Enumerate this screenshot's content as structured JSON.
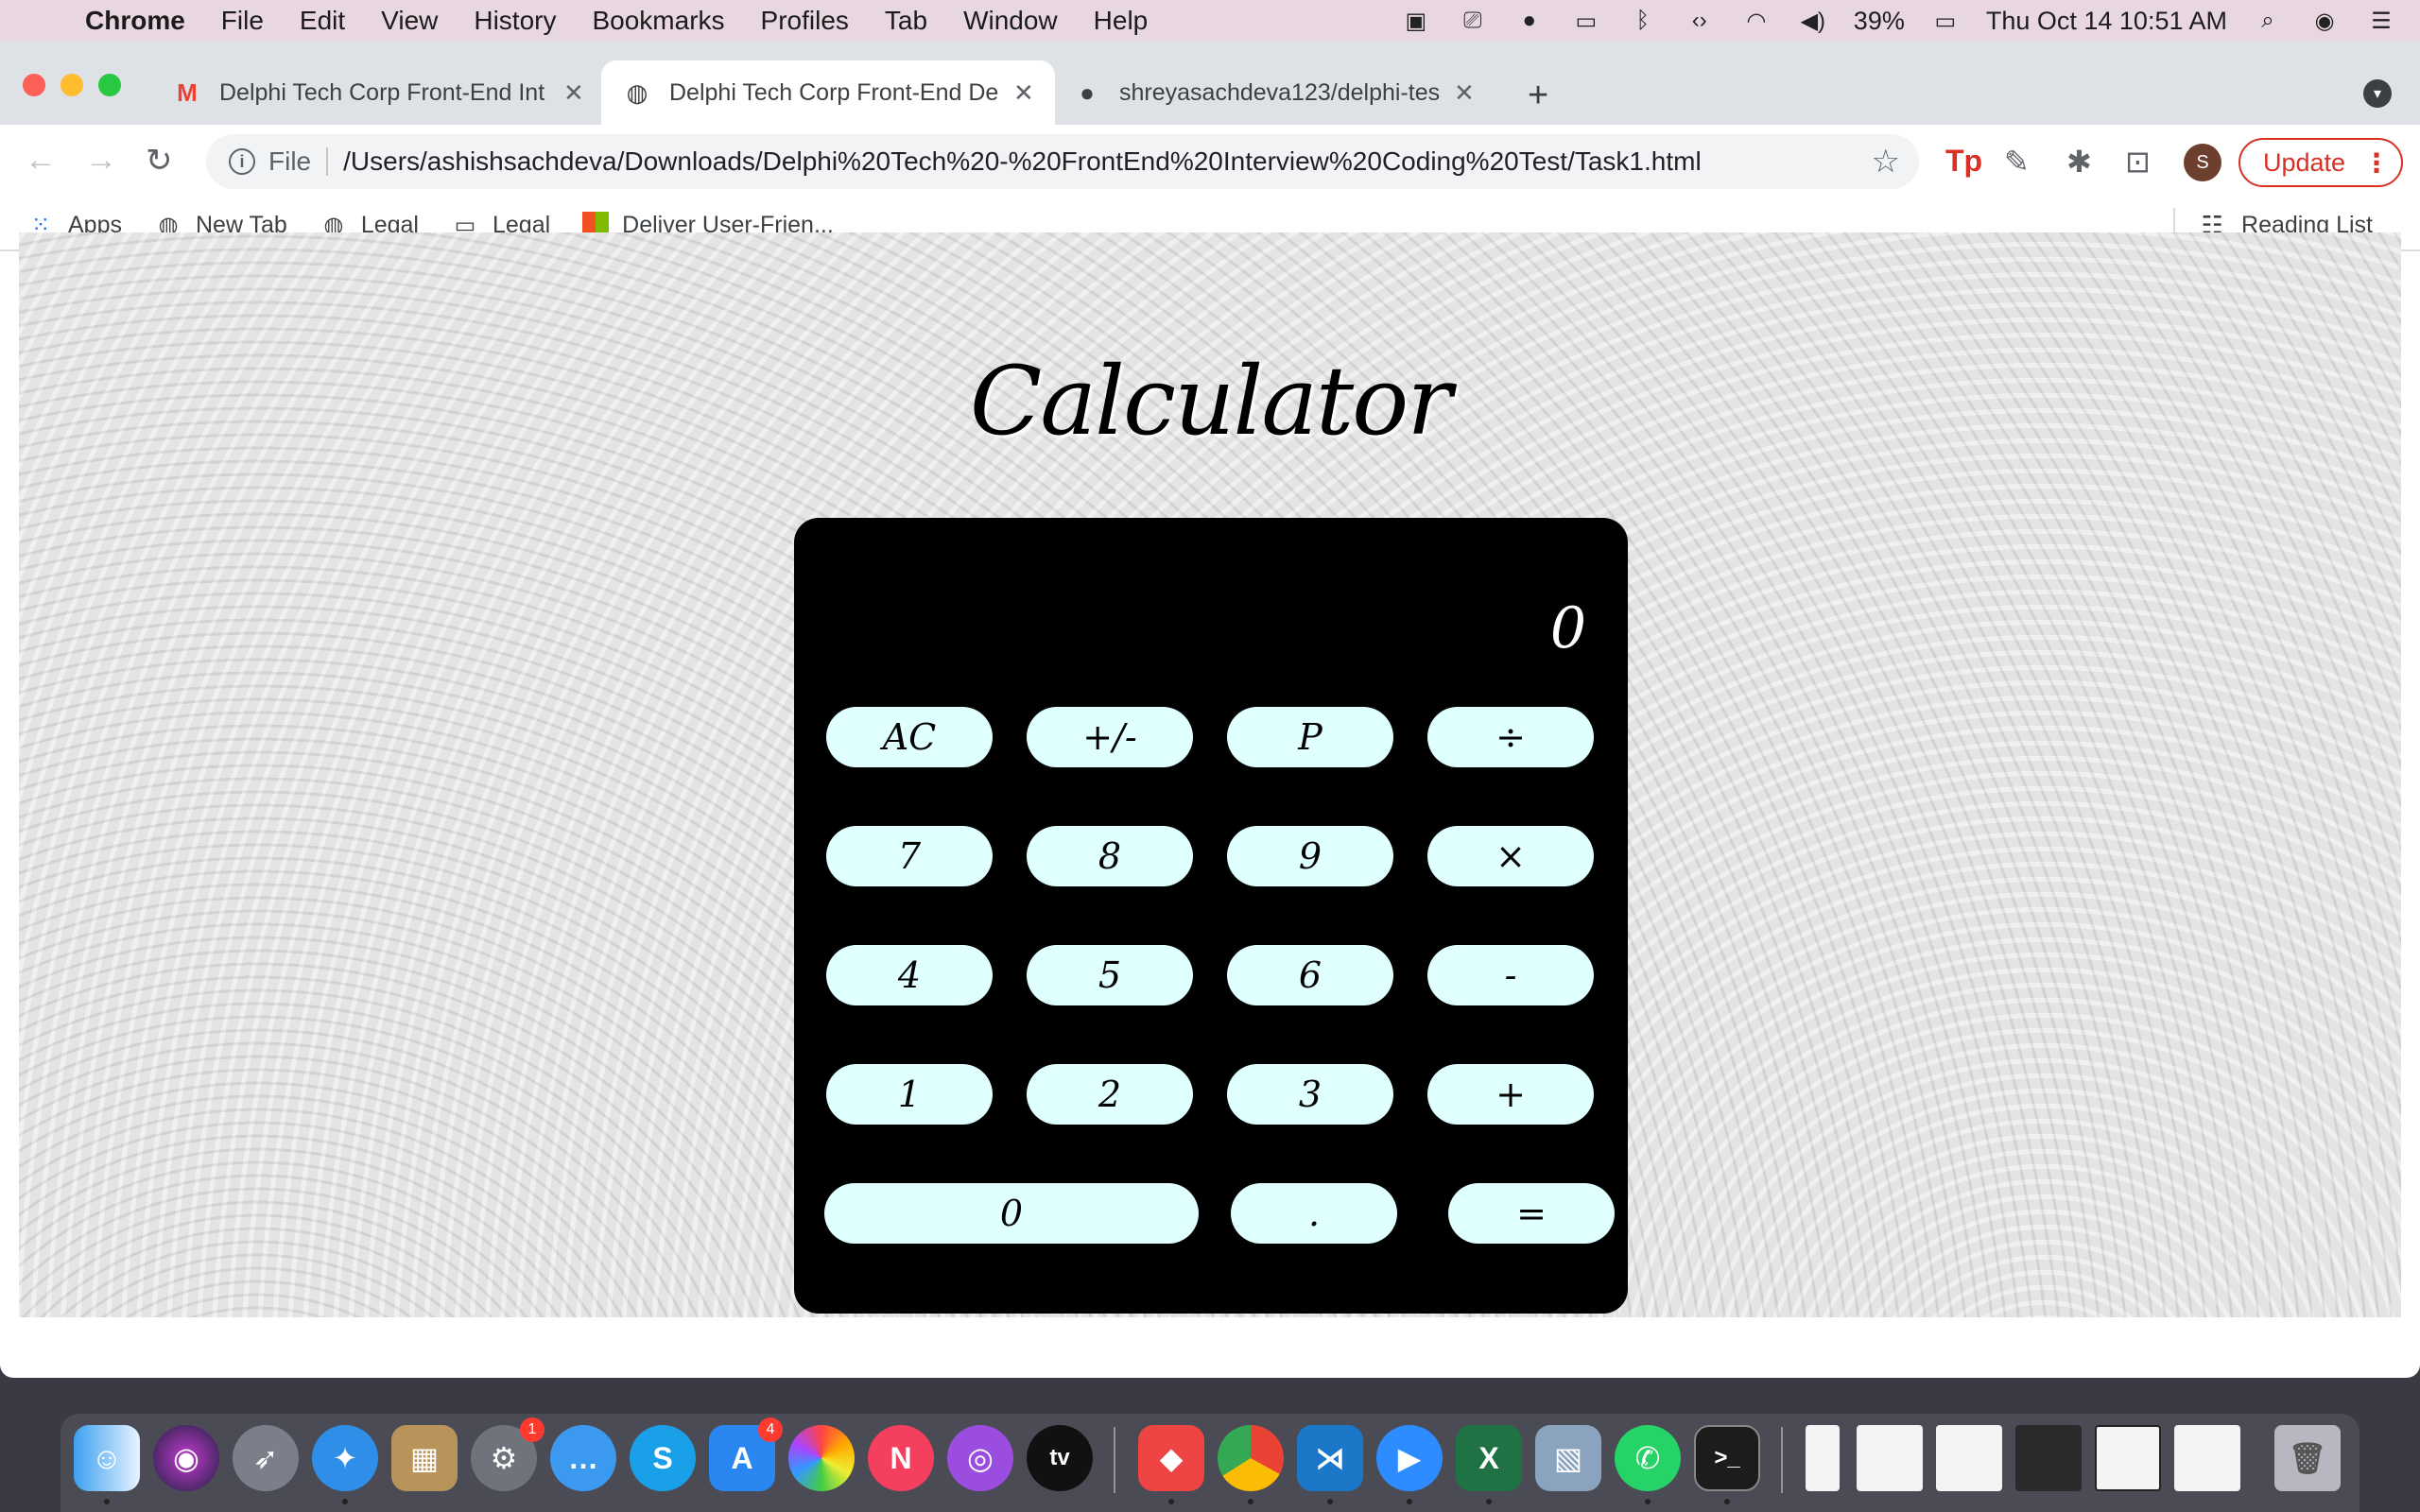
{
  "menubar": {
    "app_name": "Chrome",
    "items": [
      "File",
      "Edit",
      "View",
      "History",
      "Bookmarks",
      "Profiles",
      "Tab",
      "Window",
      "Help"
    ],
    "battery": "39%",
    "datetime": "Thu Oct 14  10:51 AM"
  },
  "tabs": [
    {
      "title": "Delphi Tech Corp Front-End Int",
      "icon": "gmail-icon"
    },
    {
      "title": "Delphi Tech Corp Front-End De",
      "icon": "globe-icon"
    },
    {
      "title": "shreyasachdeva123/delphi-tes",
      "icon": "github-icon"
    }
  ],
  "toolbar": {
    "file_label": "File",
    "url": "/Users/ashishsachdeva/Downloads/Delphi%20Tech%20-%20FrontEnd%20Interview%20Coding%20Test/Task1.html",
    "avatar_initial": "S",
    "update_label": "Update"
  },
  "bookmarks": [
    {
      "label": "Apps",
      "icon": "apps-grid-icon"
    },
    {
      "label": "New Tab",
      "icon": "globe-icon"
    },
    {
      "label": "Legal",
      "icon": "globe-icon"
    },
    {
      "label": "Legal",
      "icon": "folder-icon"
    },
    {
      "label": "Deliver User-Frien...",
      "icon": "microsoft-icon"
    }
  ],
  "reading_list": "Reading List",
  "calculator": {
    "title": "Calculator",
    "display": "0",
    "keys": {
      "ac": "AC",
      "sign": "+/-",
      "percent": "P",
      "divide": "÷",
      "seven": "7",
      "eight": "8",
      "nine": "9",
      "multiply": "×",
      "four": "4",
      "five": "5",
      "six": "6",
      "minus": "-",
      "one": "1",
      "two": "2",
      "three": "3",
      "plus": "+",
      "zero": "0",
      "decimal": ".",
      "equals": "="
    }
  },
  "dock": {
    "app_store_badge": "4",
    "settings_badge": "1"
  },
  "colors": {
    "key_background": "#e0ffff",
    "calculator_body": "#000000",
    "update_button": "#d93025"
  }
}
